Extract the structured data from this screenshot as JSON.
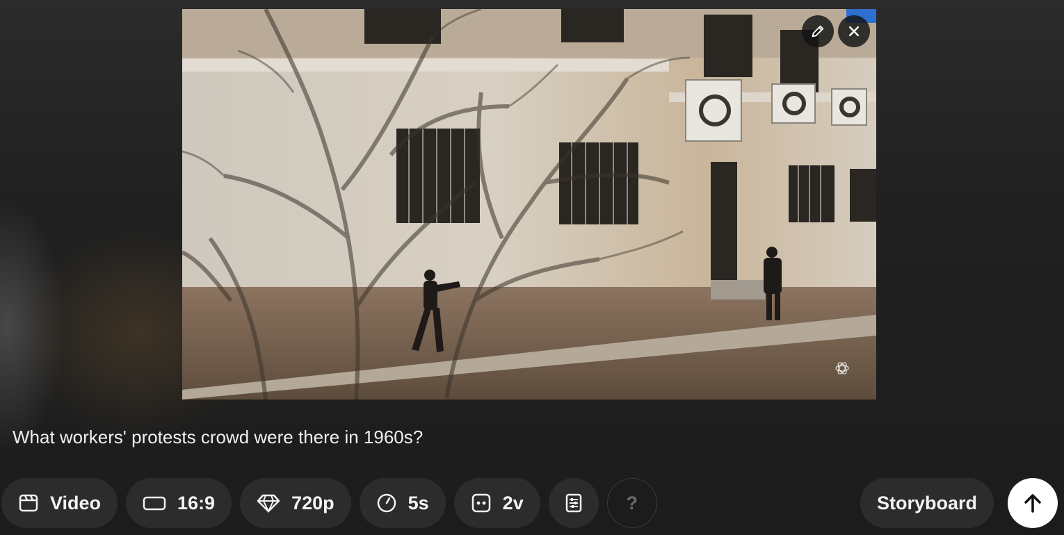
{
  "media": {
    "alt": "Photo of a weathered two-story building with tree shadows and two people on the sidewalk",
    "edit_icon": "pencil-icon",
    "close_icon": "close-icon",
    "watermark_icon": "openai-logo-icon"
  },
  "prompt": {
    "text": "What workers' protests crowd were there in 1960s?"
  },
  "toolbar": {
    "type_label": "Video",
    "type_icon": "clapperboard-icon",
    "aspect_label": "16:9",
    "aspect_icon": "rectangle-icon",
    "resolution_label": "720p",
    "resolution_icon": "diamond-icon",
    "duration_label": "5s",
    "duration_icon": "clock-icon",
    "variations_label": "2v",
    "variations_icon": "variations-icon",
    "presets_icon": "sliders-icon",
    "help_label": "?"
  },
  "actions": {
    "storyboard_label": "Storyboard",
    "submit_icon": "arrow-up-icon"
  },
  "colors": {
    "background": "#1f1f1f",
    "chip": "#2c2c2c",
    "submit": "#ffffff"
  }
}
